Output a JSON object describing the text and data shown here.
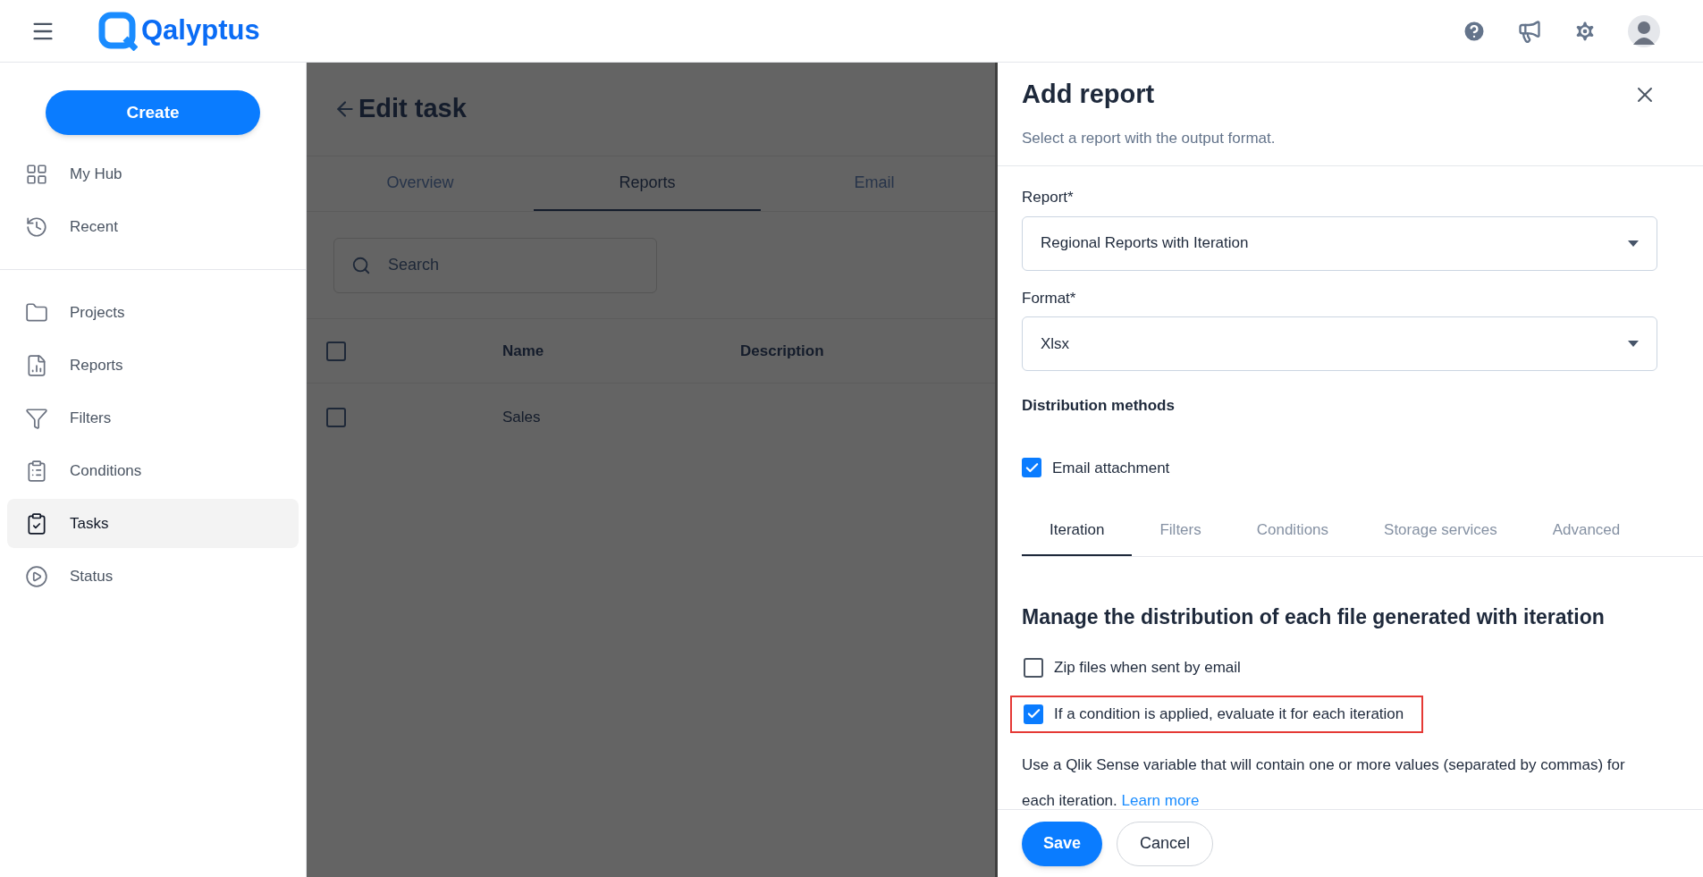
{
  "header": {
    "logo": "Qalyptus"
  },
  "sidebar": {
    "create_button": "Create",
    "groups": [
      [
        {
          "label": "My Hub",
          "kind": "grid",
          "selected": false
        },
        {
          "label": "Recent",
          "kind": "history",
          "selected": false
        }
      ],
      [
        {
          "label": "Projects",
          "kind": "folder",
          "selected": false
        },
        {
          "label": "Reports",
          "kind": "report",
          "selected": false
        },
        {
          "label": "Filters",
          "kind": "filter",
          "selected": false
        },
        {
          "label": "Conditions",
          "kind": "list",
          "selected": false
        },
        {
          "label": "Tasks",
          "kind": "task",
          "selected": true
        },
        {
          "label": "Status",
          "kind": "play",
          "selected": false
        }
      ]
    ]
  },
  "page": {
    "title": "Edit task",
    "tabs": [
      {
        "label": "Overview",
        "selected": false
      },
      {
        "label": "Reports",
        "selected": true
      },
      {
        "label": "Email",
        "selected": false
      }
    ],
    "search": {
      "placeholder": "Search"
    },
    "table": {
      "header_checked": false,
      "columns": [
        "Name",
        "Description"
      ],
      "rows": [
        {
          "checked": false,
          "cells": [
            "Sales",
            ""
          ]
        }
      ]
    }
  },
  "drawer": {
    "title": "Add report",
    "subtitle": "Select a report with the output format.",
    "fields": [
      {
        "label": "Report*",
        "value": "Regional Reports with Iteration"
      },
      {
        "label": "Format*",
        "value": "Xlsx"
      }
    ],
    "distribution_title": "Distribution methods",
    "distribution": [
      {
        "label": "Email attachment",
        "checked": true
      }
    ],
    "tabs": [
      {
        "label": "Iteration",
        "selected": true
      },
      {
        "label": "Filters",
        "selected": false
      },
      {
        "label": "Conditions",
        "selected": false
      },
      {
        "label": "Storage services",
        "selected": false
      },
      {
        "label": "Advanced",
        "selected": false
      }
    ],
    "section_title": "Manage the distribution of each file generated with iteration",
    "options": [
      {
        "label": "Zip files when sent by email",
        "checked": false,
        "highlighted": false
      },
      {
        "label": "If a condition is applied, evaluate it for each iteration",
        "checked": true,
        "highlighted": true
      }
    ],
    "help_text": "Use a Qlik Sense variable that will contain one or more values (separated by commas) for each iteration.",
    "help_link": "Learn more",
    "buttons": [
      {
        "label": "Save",
        "kind": "primary"
      },
      {
        "label": "Cancel",
        "kind": "secondary"
      }
    ]
  }
}
